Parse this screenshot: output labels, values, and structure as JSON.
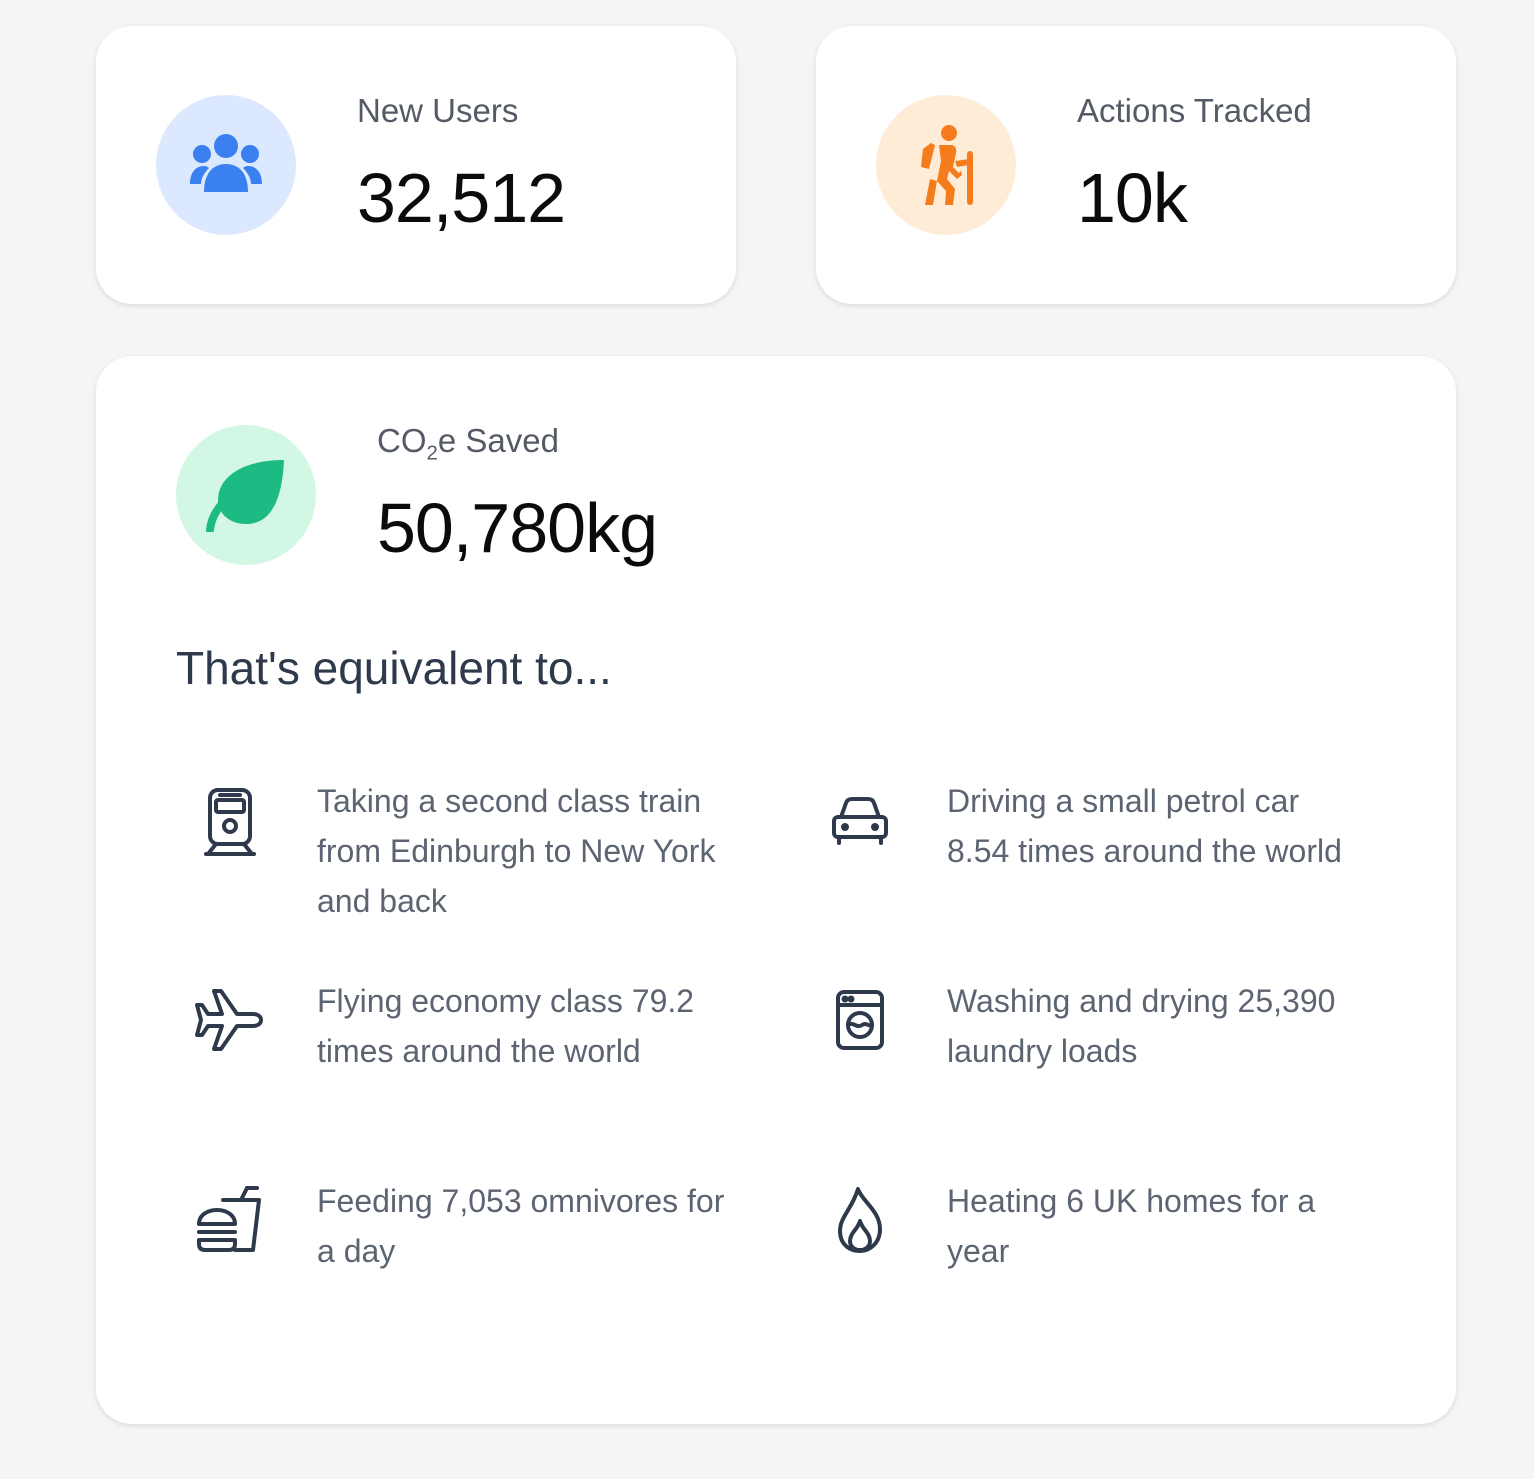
{
  "stats": {
    "users": {
      "label": "New Users",
      "value": "32,512",
      "icon": "users-group-icon",
      "bg": "#dbe8fd",
      "color": "#3b80f0"
    },
    "actions": {
      "label": "Actions Tracked",
      "value": "10k",
      "icon": "hiker-icon",
      "bg": "#ffecd6",
      "color": "#f47c1c"
    },
    "co2": {
      "label_prefix": "CO",
      "label_sub": "2",
      "label_suffix": "e Saved",
      "value": "50,780kg",
      "icon": "leaf-icon",
      "bg": "#d3f7e5",
      "color": "#1dbb84"
    }
  },
  "equivalents": {
    "heading": "That's equivalent to...",
    "items": [
      {
        "icon": "train-icon",
        "text": "Taking a second class train from Edinburgh to New York and back"
      },
      {
        "icon": "car-icon",
        "text": "Driving a small petrol car 8.54 times around the world"
      },
      {
        "icon": "airplane-icon",
        "text": "Flying economy class 79.2 times around the world"
      },
      {
        "icon": "washing-machine-icon",
        "text": "Washing and drying 25,390 laundry loads"
      },
      {
        "icon": "fast-food-icon",
        "text": "Feeding 7,053 omnivores for a day"
      },
      {
        "icon": "flame-icon",
        "text": "Heating 6 UK homes for a year"
      }
    ]
  },
  "colors": {
    "icon_stroke": "#2e3a4c",
    "text": "#5c6472",
    "background": "#f4f5f5"
  }
}
